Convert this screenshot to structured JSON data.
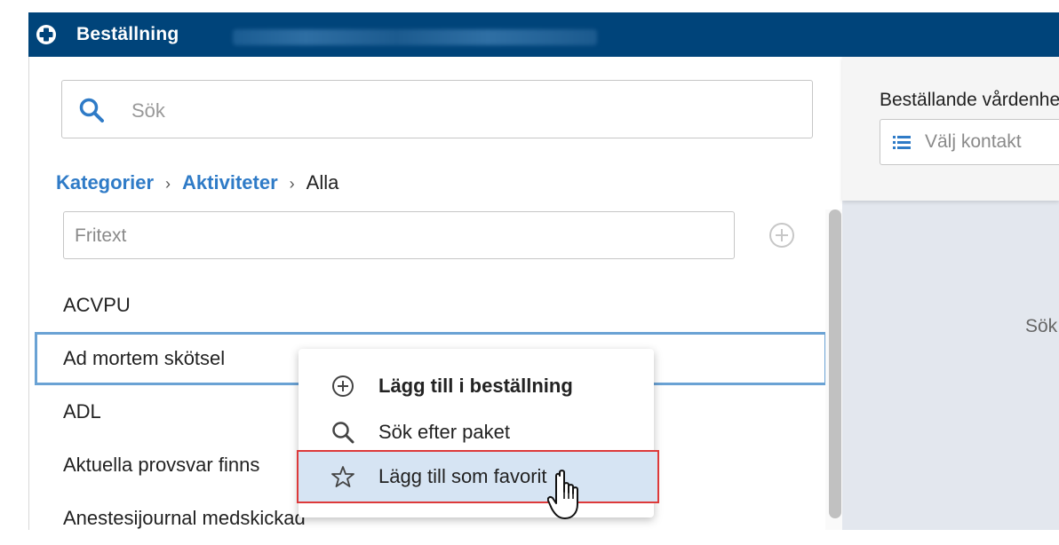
{
  "titlebar": {
    "title": "Beställning",
    "logo_icon": "plus-circle-logo-icon",
    "background": "#00447a"
  },
  "search": {
    "placeholder": "Sök",
    "value": ""
  },
  "breadcrumb": {
    "items": [
      {
        "label": "Kategorier",
        "link": true
      },
      {
        "label": "Aktiviteter",
        "link": true
      },
      {
        "label": "Alla",
        "link": false
      }
    ],
    "separator": "›"
  },
  "fritext": {
    "placeholder": "Fritext",
    "value": ""
  },
  "activities": [
    {
      "label": "ACVPU"
    },
    {
      "label": "Ad mortem skötsel",
      "selected": true
    },
    {
      "label": "ADL"
    },
    {
      "label": "Aktuella provsvar finns"
    },
    {
      "label": "Anestesijournal medskickad"
    }
  ],
  "right": {
    "ordering_label": "Beställande vårdenhet",
    "contact_placeholder": "Välj kontakt",
    "body_text": "Sök"
  },
  "context_menu": {
    "items": [
      {
        "label": "Lägg till i beställning",
        "icon": "plus-circle-icon",
        "bold": true
      },
      {
        "label": "Sök efter paket",
        "icon": "search-icon",
        "bold": false
      },
      {
        "label": "Lägg till som favorit",
        "icon": "star-icon",
        "bold": false,
        "highlighted": true
      }
    ]
  },
  "colors": {
    "accent_link": "#2f7bc7",
    "selected_border": "#6aa2d4",
    "menu_highlight": "#d6e4f3",
    "callout_red": "#dd3a3a"
  }
}
